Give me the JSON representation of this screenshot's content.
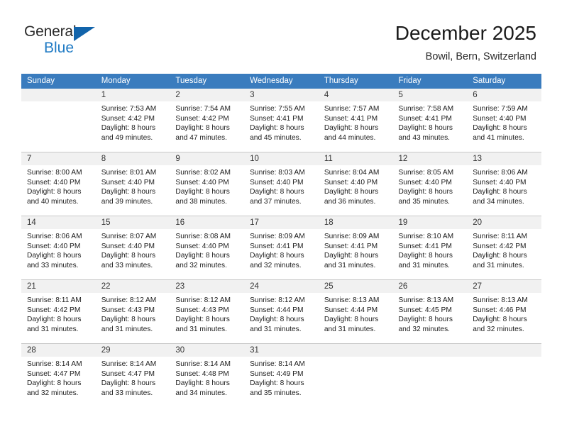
{
  "brand": {
    "name_top": "General",
    "name_bottom": "Blue",
    "triangle_color": "#1264ab",
    "blue_color": "#1f7ac4"
  },
  "header": {
    "title": "December 2025",
    "location": "Bowil, Bern, Switzerland"
  },
  "theme": {
    "header_row_bg": "#3a7cbe",
    "header_row_text": "#ffffff",
    "daynum_bg": "#f1f1f1",
    "grid_line": "#c8c8c8"
  },
  "weekdays": [
    "Sunday",
    "Monday",
    "Tuesday",
    "Wednesday",
    "Thursday",
    "Friday",
    "Saturday"
  ],
  "weeks": [
    [
      {
        "day": "",
        "lines": []
      },
      {
        "day": "1",
        "lines": [
          "Sunrise: 7:53 AM",
          "Sunset: 4:42 PM",
          "Daylight: 8 hours",
          "and 49 minutes."
        ]
      },
      {
        "day": "2",
        "lines": [
          "Sunrise: 7:54 AM",
          "Sunset: 4:42 PM",
          "Daylight: 8 hours",
          "and 47 minutes."
        ]
      },
      {
        "day": "3",
        "lines": [
          "Sunrise: 7:55 AM",
          "Sunset: 4:41 PM",
          "Daylight: 8 hours",
          "and 45 minutes."
        ]
      },
      {
        "day": "4",
        "lines": [
          "Sunrise: 7:57 AM",
          "Sunset: 4:41 PM",
          "Daylight: 8 hours",
          "and 44 minutes."
        ]
      },
      {
        "day": "5",
        "lines": [
          "Sunrise: 7:58 AM",
          "Sunset: 4:41 PM",
          "Daylight: 8 hours",
          "and 43 minutes."
        ]
      },
      {
        "day": "6",
        "lines": [
          "Sunrise: 7:59 AM",
          "Sunset: 4:40 PM",
          "Daylight: 8 hours",
          "and 41 minutes."
        ]
      }
    ],
    [
      {
        "day": "7",
        "lines": [
          "Sunrise: 8:00 AM",
          "Sunset: 4:40 PM",
          "Daylight: 8 hours",
          "and 40 minutes."
        ]
      },
      {
        "day": "8",
        "lines": [
          "Sunrise: 8:01 AM",
          "Sunset: 4:40 PM",
          "Daylight: 8 hours",
          "and 39 minutes."
        ]
      },
      {
        "day": "9",
        "lines": [
          "Sunrise: 8:02 AM",
          "Sunset: 4:40 PM",
          "Daylight: 8 hours",
          "and 38 minutes."
        ]
      },
      {
        "day": "10",
        "lines": [
          "Sunrise: 8:03 AM",
          "Sunset: 4:40 PM",
          "Daylight: 8 hours",
          "and 37 minutes."
        ]
      },
      {
        "day": "11",
        "lines": [
          "Sunrise: 8:04 AM",
          "Sunset: 4:40 PM",
          "Daylight: 8 hours",
          "and 36 minutes."
        ]
      },
      {
        "day": "12",
        "lines": [
          "Sunrise: 8:05 AM",
          "Sunset: 4:40 PM",
          "Daylight: 8 hours",
          "and 35 minutes."
        ]
      },
      {
        "day": "13",
        "lines": [
          "Sunrise: 8:06 AM",
          "Sunset: 4:40 PM",
          "Daylight: 8 hours",
          "and 34 minutes."
        ]
      }
    ],
    [
      {
        "day": "14",
        "lines": [
          "Sunrise: 8:06 AM",
          "Sunset: 4:40 PM",
          "Daylight: 8 hours",
          "and 33 minutes."
        ]
      },
      {
        "day": "15",
        "lines": [
          "Sunrise: 8:07 AM",
          "Sunset: 4:40 PM",
          "Daylight: 8 hours",
          "and 33 minutes."
        ]
      },
      {
        "day": "16",
        "lines": [
          "Sunrise: 8:08 AM",
          "Sunset: 4:40 PM",
          "Daylight: 8 hours",
          "and 32 minutes."
        ]
      },
      {
        "day": "17",
        "lines": [
          "Sunrise: 8:09 AM",
          "Sunset: 4:41 PM",
          "Daylight: 8 hours",
          "and 32 minutes."
        ]
      },
      {
        "day": "18",
        "lines": [
          "Sunrise: 8:09 AM",
          "Sunset: 4:41 PM",
          "Daylight: 8 hours",
          "and 31 minutes."
        ]
      },
      {
        "day": "19",
        "lines": [
          "Sunrise: 8:10 AM",
          "Sunset: 4:41 PM",
          "Daylight: 8 hours",
          "and 31 minutes."
        ]
      },
      {
        "day": "20",
        "lines": [
          "Sunrise: 8:11 AM",
          "Sunset: 4:42 PM",
          "Daylight: 8 hours",
          "and 31 minutes."
        ]
      }
    ],
    [
      {
        "day": "21",
        "lines": [
          "Sunrise: 8:11 AM",
          "Sunset: 4:42 PM",
          "Daylight: 8 hours",
          "and 31 minutes."
        ]
      },
      {
        "day": "22",
        "lines": [
          "Sunrise: 8:12 AM",
          "Sunset: 4:43 PM",
          "Daylight: 8 hours",
          "and 31 minutes."
        ]
      },
      {
        "day": "23",
        "lines": [
          "Sunrise: 8:12 AM",
          "Sunset: 4:43 PM",
          "Daylight: 8 hours",
          "and 31 minutes."
        ]
      },
      {
        "day": "24",
        "lines": [
          "Sunrise: 8:12 AM",
          "Sunset: 4:44 PM",
          "Daylight: 8 hours",
          "and 31 minutes."
        ]
      },
      {
        "day": "25",
        "lines": [
          "Sunrise: 8:13 AM",
          "Sunset: 4:44 PM",
          "Daylight: 8 hours",
          "and 31 minutes."
        ]
      },
      {
        "day": "26",
        "lines": [
          "Sunrise: 8:13 AM",
          "Sunset: 4:45 PM",
          "Daylight: 8 hours",
          "and 32 minutes."
        ]
      },
      {
        "day": "27",
        "lines": [
          "Sunrise: 8:13 AM",
          "Sunset: 4:46 PM",
          "Daylight: 8 hours",
          "and 32 minutes."
        ]
      }
    ],
    [
      {
        "day": "28",
        "lines": [
          "Sunrise: 8:14 AM",
          "Sunset: 4:47 PM",
          "Daylight: 8 hours",
          "and 32 minutes."
        ]
      },
      {
        "day": "29",
        "lines": [
          "Sunrise: 8:14 AM",
          "Sunset: 4:47 PM",
          "Daylight: 8 hours",
          "and 33 minutes."
        ]
      },
      {
        "day": "30",
        "lines": [
          "Sunrise: 8:14 AM",
          "Sunset: 4:48 PM",
          "Daylight: 8 hours",
          "and 34 minutes."
        ]
      },
      {
        "day": "31",
        "lines": [
          "Sunrise: 8:14 AM",
          "Sunset: 4:49 PM",
          "Daylight: 8 hours",
          "and 35 minutes."
        ]
      },
      {
        "day": "",
        "lines": []
      },
      {
        "day": "",
        "lines": []
      },
      {
        "day": "",
        "lines": []
      }
    ]
  ]
}
